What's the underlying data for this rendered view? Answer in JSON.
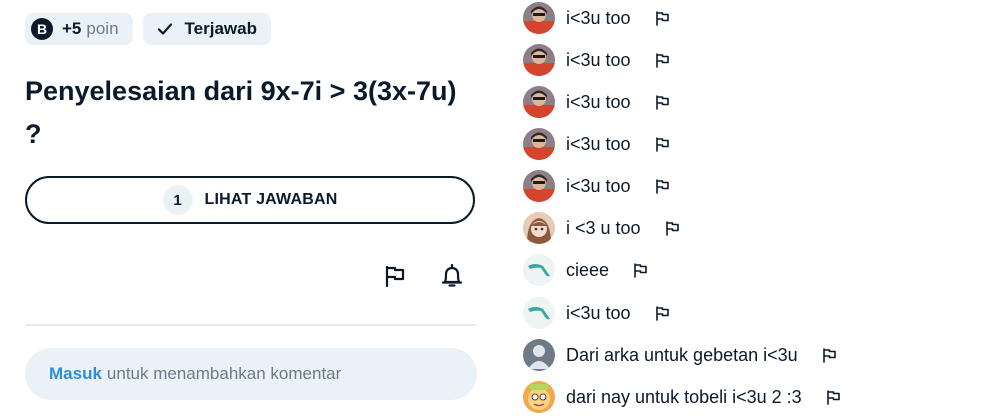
{
  "question_card": {
    "points_badge": {
      "icon": "brainly-coin-icon",
      "icon_letter": "B",
      "value": "+5",
      "unit": "poin"
    },
    "status_badge": {
      "icon": "check-icon",
      "label": "Terjawab"
    },
    "question_text": "Penyelesaian dari 9x-7i > 3(3x-7u) ?",
    "answer_button": {
      "count": "1",
      "label": "LIHAT JAWABAN"
    },
    "actions": [
      "flag-icon",
      "bell-icon"
    ],
    "comment_input": {
      "login_link": "Masuk",
      "prompt": "untuk menambahkan komentar"
    }
  },
  "comments": [
    {
      "avatar": "avatar-red-shirt",
      "text": "i<3u too"
    },
    {
      "avatar": "avatar-red-shirt",
      "text": "i<3u too"
    },
    {
      "avatar": "avatar-red-shirt",
      "text": "i<3u too"
    },
    {
      "avatar": "avatar-red-shirt",
      "text": "i<3u too"
    },
    {
      "avatar": "avatar-red-shirt",
      "text": "i<3u too"
    },
    {
      "avatar": "avatar-anime-girl",
      "text": "i <3 u too"
    },
    {
      "avatar": "avatar-teal-bird",
      "text": "cieee"
    },
    {
      "avatar": "avatar-teal-bird",
      "text": "i<3u too"
    },
    {
      "avatar": "avatar-default-gray",
      "text": "Dari arka untuk gebetan i<3u"
    },
    {
      "avatar": "avatar-cartoon",
      "text": "dari nay untuk tobeli i<3u 2 :3"
    }
  ],
  "colors": {
    "text": "#0b1a2a",
    "badge_bg": "#ebf2f7",
    "link": "#2e8dd6",
    "muted": "#6b7a89"
  }
}
